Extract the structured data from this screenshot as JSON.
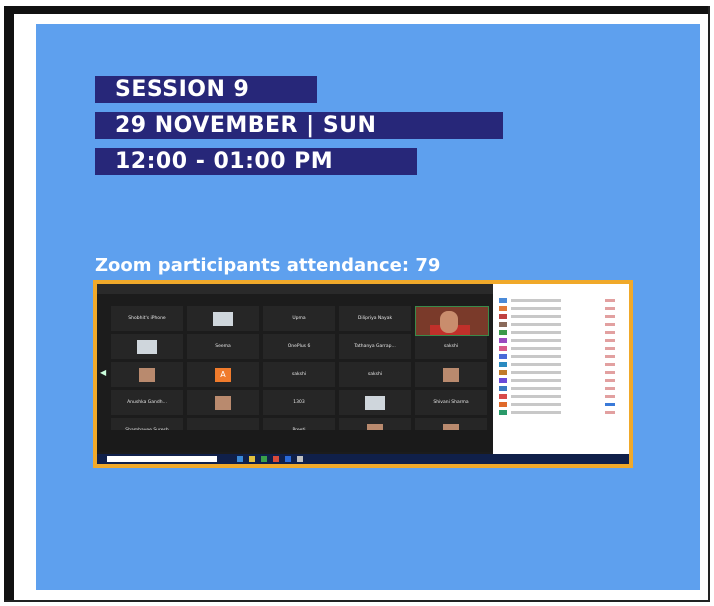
{
  "poster": {
    "session": "SESSION 9",
    "date": "29 NOVEMBER | SUN",
    "time": "12:00 - 01:00 PM",
    "attendance": "Zoom participants attendance: 79"
  },
  "zoom_tiles": [
    "Shobhit's iPhone",
    "",
    "Upma",
    "Dilipriya Nayak",
    "",
    "Seema",
    "OnePlus 6",
    "Tathanya Garrap...",
    "sakshi",
    "",
    "",
    "sakshi",
    "sakshi",
    "",
    "Anushka Gandh...",
    "",
    "1303",
    "",
    "Shivani Sharma",
    "Shambavee Suresh",
    "",
    "Preeti",
    "",
    ""
  ],
  "colors": {
    "poster_bg": "#5ea0ee",
    "banner_bg": "#272779",
    "screenshot_border": "#f0a92a"
  }
}
